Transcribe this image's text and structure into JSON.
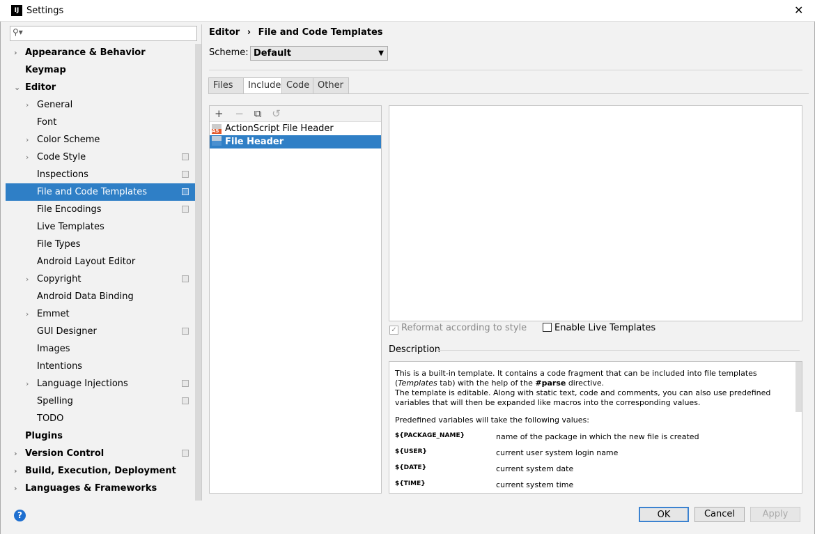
{
  "window": {
    "title": "Settings",
    "close": "✕"
  },
  "search": {
    "placeholder": ""
  },
  "sidebar": {
    "items": [
      {
        "label": "Appearance & Behavior",
        "level": 0,
        "bold": true,
        "arrow": "›"
      },
      {
        "label": "Keymap",
        "level": 0,
        "bold": true
      },
      {
        "label": "Editor",
        "level": 0,
        "bold": true,
        "arrow": "⌄"
      },
      {
        "label": "General",
        "level": 1,
        "arrow": "›"
      },
      {
        "label": "Font",
        "level": 1
      },
      {
        "label": "Color Scheme",
        "level": 1,
        "arrow": "›"
      },
      {
        "label": "Code Style",
        "level": 1,
        "arrow": "›",
        "copy": true
      },
      {
        "label": "Inspections",
        "level": 1,
        "copy": true
      },
      {
        "label": "File and Code Templates",
        "level": 1,
        "copy": true,
        "selected": true
      },
      {
        "label": "File Encodings",
        "level": 1,
        "copy": true
      },
      {
        "label": "Live Templates",
        "level": 1
      },
      {
        "label": "File Types",
        "level": 1
      },
      {
        "label": "Android Layout Editor",
        "level": 1
      },
      {
        "label": "Copyright",
        "level": 1,
        "arrow": "›",
        "copy": true
      },
      {
        "label": "Android Data Binding",
        "level": 1
      },
      {
        "label": "Emmet",
        "level": 1,
        "arrow": "›"
      },
      {
        "label": "GUI Designer",
        "level": 1,
        "copy": true
      },
      {
        "label": "Images",
        "level": 1
      },
      {
        "label": "Intentions",
        "level": 1
      },
      {
        "label": "Language Injections",
        "level": 1,
        "arrow": "›",
        "copy": true
      },
      {
        "label": "Spelling",
        "level": 1,
        "copy": true
      },
      {
        "label": "TODO",
        "level": 1
      },
      {
        "label": "Plugins",
        "level": 0,
        "bold": true
      },
      {
        "label": "Version Control",
        "level": 0,
        "bold": true,
        "arrow": "›",
        "copy": true
      },
      {
        "label": "Build, Execution, Deployment",
        "level": 0,
        "bold": true,
        "arrow": "›"
      },
      {
        "label": "Languages & Frameworks",
        "level": 0,
        "bold": true,
        "arrow": "›"
      }
    ]
  },
  "breadcrumb": {
    "parent": "Editor",
    "sep": "›",
    "current": "File and Code Templates"
  },
  "scheme": {
    "label": "Scheme:",
    "value": "Default"
  },
  "tabs": [
    "Files",
    "Includes",
    "Code",
    "Other"
  ],
  "active_tab": "Includes",
  "toolbar": {
    "add": "+",
    "remove": "−",
    "copy": "⧉",
    "reset": "↺"
  },
  "templates": [
    {
      "label": "ActionScript File Header",
      "icon": "AS"
    },
    {
      "label": "File Header",
      "selected": true
    }
  ],
  "editor": {
    "content": ""
  },
  "options": {
    "reformat": {
      "label": "Reformat according to style",
      "checked": true,
      "disabled": true
    },
    "live": {
      "label": "Enable Live Templates",
      "checked": false
    }
  },
  "description": {
    "label": "Description",
    "p1a": "This is a built-in template. It contains a code fragment that can be included into file templates (",
    "p1i": "Templates",
    "p1b": " tab) with the help of the ",
    "p1bold": "#parse",
    "p1c": " directive.",
    "p2": "The template is editable. Along with static text, code and comments, you can also use predefined variables that will then be expanded like macros into the corresponding values.",
    "p3": "Predefined variables will take the following values:",
    "vars": [
      {
        "name": "${PACKAGE_NAME}",
        "desc": "name of the package in which the new file is created"
      },
      {
        "name": "${USER}",
        "desc": "current user system login name"
      },
      {
        "name": "${DATE}",
        "desc": "current system date"
      },
      {
        "name": "${TIME}",
        "desc": "current system time"
      }
    ]
  },
  "buttons": {
    "ok": "OK",
    "cancel": "Cancel",
    "apply": "Apply",
    "help": "?"
  }
}
